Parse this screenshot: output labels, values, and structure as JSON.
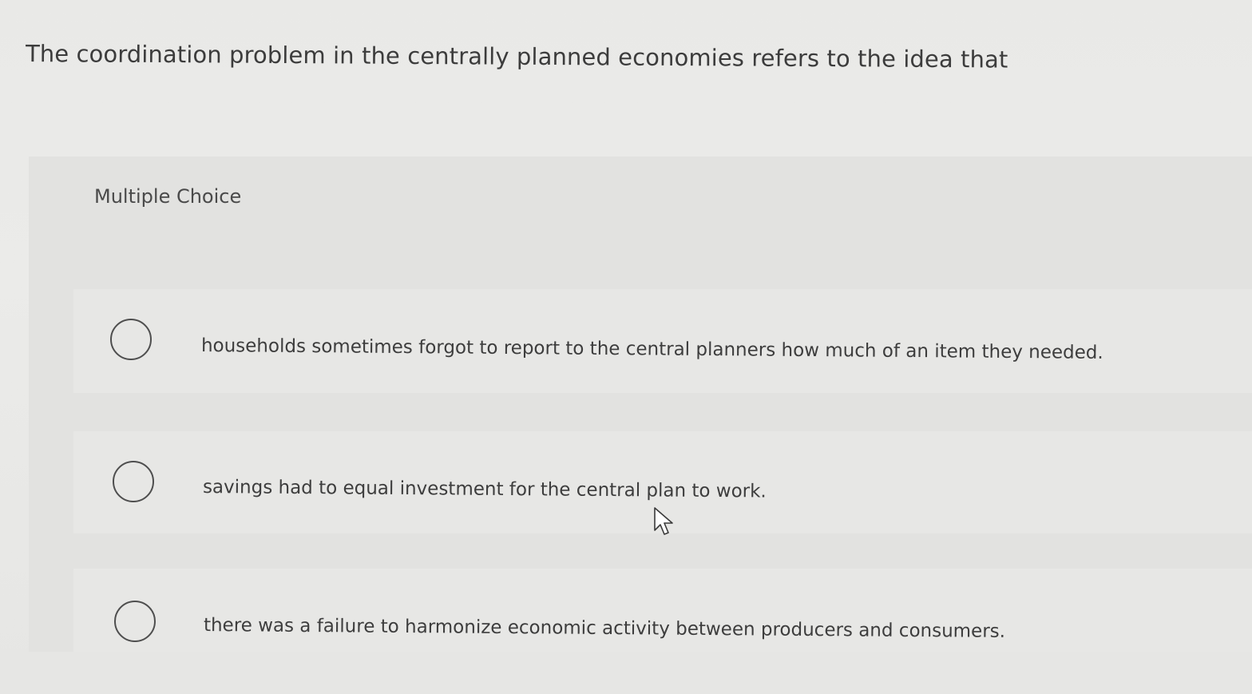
{
  "question": {
    "text": "The coordination problem in the centrally planned economies refers to the idea that"
  },
  "answer_panel": {
    "type_label": "Multiple Choice",
    "options": [
      {
        "text": "households sometimes forgot to report to the central planners how much of an item they needed.",
        "selected": false
      },
      {
        "text": "savings had to equal investment for the central plan to work.",
        "selected": false
      },
      {
        "text": "there was a failure to harmonize economic activity between producers and consumers.",
        "selected": false
      }
    ]
  },
  "icons": {
    "radio": "radio-button-icon",
    "cursor": "mouse-pointer-icon"
  },
  "colors": {
    "background": "#e9e9e7",
    "panel": "#e2e2e0",
    "text": "#3c3c3c"
  }
}
